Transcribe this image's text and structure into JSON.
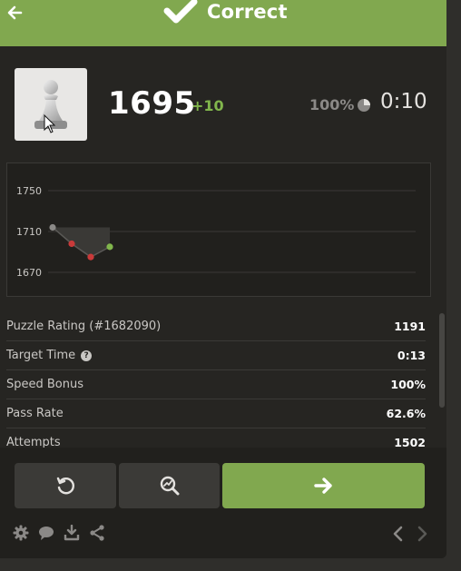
{
  "header": {
    "status_label": "Correct",
    "back_icon": "arrow-left-icon",
    "status_icon": "checkmark-icon",
    "color": "#81a84f"
  },
  "rating": {
    "value": "1695",
    "delta": "+10",
    "delta_color": "#81b64c",
    "accuracy": "100%",
    "timer": "0:10",
    "piece_icon": "pawn-icon"
  },
  "chart_data": {
    "type": "line",
    "y_ticks": [
      "1750",
      "1710",
      "1670"
    ],
    "ylim": [
      1670,
      1750
    ],
    "points": [
      {
        "x": 0,
        "y": 1714,
        "kind": "start"
      },
      {
        "x": 1,
        "y": 1698,
        "kind": "fail"
      },
      {
        "x": 2,
        "y": 1685,
        "kind": "fail"
      },
      {
        "x": 3,
        "y": 1695,
        "kind": "success"
      }
    ],
    "colors": {
      "start": "#8b8987",
      "fail": "#c93a3a",
      "success": "#81b64c",
      "line": "#5a5956",
      "fill": "#3a3936"
    }
  },
  "stats": [
    {
      "label": "Puzzle Rating (#1682090)",
      "value": "1191"
    },
    {
      "label": "Target Time",
      "value": "0:13",
      "help": "?"
    },
    {
      "label": "Speed Bonus",
      "value": "100%"
    },
    {
      "label": "Pass Rate",
      "value": "62.6%"
    },
    {
      "label": "Attempts",
      "value": "1502"
    }
  ],
  "actions": {
    "retry_icon": "retry-icon",
    "analyze_icon": "analysis-icon",
    "next_icon": "arrow-right-icon"
  },
  "toolbar": {
    "icons": [
      "gear-icon",
      "chat-icon",
      "download-icon",
      "share-icon"
    ],
    "nav": [
      "chevron-left-icon",
      "chevron-right-icon"
    ]
  }
}
